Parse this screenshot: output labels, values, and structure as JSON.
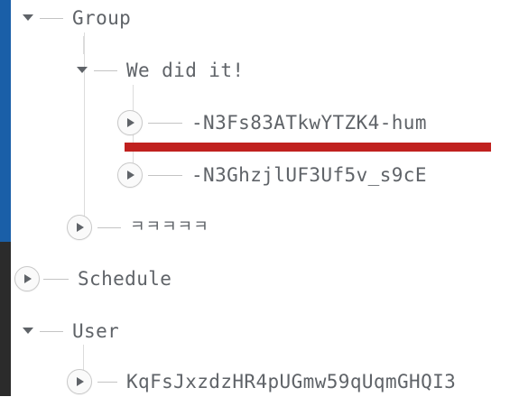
{
  "tree": {
    "nodes": [
      {
        "id": "group",
        "label": "Group",
        "state": "expanded"
      },
      {
        "id": "we-did-it",
        "label": "We did it!",
        "state": "expanded"
      },
      {
        "id": "child-1",
        "label": "-N3Fs83ATkwYTZK4-hum",
        "state": "collapsed"
      },
      {
        "id": "child-2",
        "label": "-N3GhzjlUF3Uf5v_s9cE",
        "state": "collapsed"
      },
      {
        "id": "kkkk",
        "label": "ㅋㅋㅋㅋㅋ",
        "state": "collapsed"
      },
      {
        "id": "schedule",
        "label": "Schedule",
        "state": "collapsed"
      },
      {
        "id": "user",
        "label": "User",
        "state": "expanded"
      },
      {
        "id": "user-key",
        "label": "KqFsJxzdzHR4pUGmw59qUqmGHQI3",
        "state": "collapsed"
      }
    ]
  },
  "annotation": {
    "underline_color": "#c0211f"
  }
}
